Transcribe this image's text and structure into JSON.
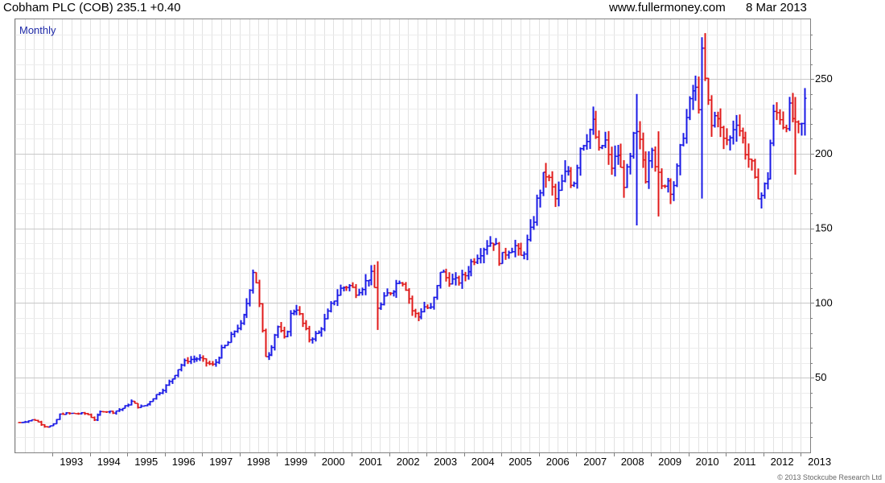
{
  "header": {
    "title": "Cobham PLC (COB) 235.1 +0.40",
    "website": "www.fullermoney.com",
    "date": "8 Mar 2013"
  },
  "copyright": "© 2013 Stockcube Research Ltd",
  "colors": {
    "up": "#1a1ae6",
    "down": "#e01a1a",
    "label": "#1f2aa8"
  },
  "chart_data": {
    "type": "bar",
    "subtype": "ohlc-monthly",
    "period_label": "Monthly",
    "x_range": [
      1992.0,
      2013.25
    ],
    "y_range": [
      0,
      290
    ],
    "y_ticks": [
      50,
      100,
      150,
      200,
      250
    ],
    "y_tick_labels": [
      "50",
      "100",
      "150",
      "200",
      "250"
    ],
    "x_ticks": [
      1993,
      1994,
      1995,
      1996,
      1997,
      1998,
      1999,
      2000,
      2001,
      2002,
      2003,
      2004,
      2005,
      2006,
      2007,
      2008,
      2009,
      2010,
      2011,
      2012,
      2013
    ],
    "x_tick_labels": [
      "1993",
      "1994",
      "1995",
      "1996",
      "1997",
      "1998",
      "1999",
      "2000",
      "2001",
      "2002",
      "2003",
      "2004",
      "2005",
      "2006",
      "2007",
      "2008",
      "2009",
      "2010",
      "2011",
      "2012",
      "2013"
    ],
    "close_anchors": [
      [
        1992.1,
        20
      ],
      [
        1992.5,
        22
      ],
      [
        1992.8,
        17
      ],
      [
        1993.0,
        18
      ],
      [
        1993.2,
        26
      ],
      [
        1993.6,
        26
      ],
      [
        1993.9,
        26
      ],
      [
        1994.1,
        22
      ],
      [
        1994.3,
        28
      ],
      [
        1994.6,
        27
      ],
      [
        1994.9,
        30
      ],
      [
        1995.1,
        34
      ],
      [
        1995.3,
        30
      ],
      [
        1995.5,
        32
      ],
      [
        1995.7,
        37
      ],
      [
        1996.0,
        44
      ],
      [
        1996.2,
        50
      ],
      [
        1996.4,
        58
      ],
      [
        1996.6,
        62
      ],
      [
        1996.9,
        63
      ],
      [
        1997.1,
        60
      ],
      [
        1997.3,
        58
      ],
      [
        1997.5,
        68
      ],
      [
        1997.7,
        74
      ],
      [
        1997.9,
        84
      ],
      [
        1998.05,
        85
      ],
      [
        1998.2,
        102
      ],
      [
        1998.35,
        122
      ],
      [
        1998.45,
        113
      ],
      [
        1998.6,
        80
      ],
      [
        1998.7,
        62
      ],
      [
        1998.85,
        72
      ],
      [
        1999.0,
        85
      ],
      [
        1999.2,
        75
      ],
      [
        1999.35,
        92
      ],
      [
        1999.5,
        98
      ],
      [
        1999.7,
        85
      ],
      [
        1999.85,
        76
      ],
      [
        2000.1,
        80
      ],
      [
        2000.3,
        90
      ],
      [
        2000.5,
        102
      ],
      [
        2000.7,
        110
      ],
      [
        2000.9,
        112
      ],
      [
        2001.1,
        108
      ],
      [
        2001.3,
        112
      ],
      [
        2001.5,
        120
      ],
      [
        2001.6,
        110
      ],
      [
        2001.7,
        95
      ],
      [
        2001.9,
        105
      ],
      [
        2002.1,
        110
      ],
      [
        2002.3,
        117
      ],
      [
        2002.45,
        110
      ],
      [
        2002.6,
        95
      ],
      [
        2002.75,
        90
      ],
      [
        2002.9,
        98
      ],
      [
        2003.1,
        96
      ],
      [
        2003.25,
        108
      ],
      [
        2003.35,
        122
      ],
      [
        2003.55,
        116
      ],
      [
        2003.8,
        114
      ],
      [
        2004.0,
        118
      ],
      [
        2004.2,
        128
      ],
      [
        2004.4,
        134
      ],
      [
        2004.6,
        140
      ],
      [
        2004.8,
        142
      ],
      [
        2004.95,
        128
      ],
      [
        2005.15,
        136
      ],
      [
        2005.35,
        138
      ],
      [
        2005.5,
        130
      ],
      [
        2005.65,
        138
      ],
      [
        2005.8,
        150
      ],
      [
        2005.95,
        170
      ],
      [
        2006.15,
        188
      ],
      [
        2006.3,
        180
      ],
      [
        2006.45,
        168
      ],
      [
        2006.6,
        180
      ],
      [
        2006.75,
        190
      ],
      [
        2006.9,
        178
      ],
      [
        2007.1,
        205
      ],
      [
        2007.3,
        214
      ],
      [
        2007.45,
        220
      ],
      [
        2007.6,
        200
      ],
      [
        2007.75,
        210
      ],
      [
        2007.9,
        190
      ],
      [
        2008.1,
        200
      ],
      [
        2008.25,
        180
      ],
      [
        2008.4,
        190
      ],
      [
        2008.55,
        215
      ],
      [
        2008.7,
        205
      ],
      [
        2008.85,
        185
      ],
      [
        2009.0,
        210
      ],
      [
        2009.1,
        195
      ],
      [
        2009.25,
        175
      ],
      [
        2009.4,
        185
      ],
      [
        2009.55,
        175
      ],
      [
        2009.7,
        190
      ],
      [
        2009.85,
        215
      ],
      [
        2010.0,
        230
      ],
      [
        2010.15,
        248
      ],
      [
        2010.25,
        228
      ],
      [
        2010.35,
        265
      ],
      [
        2010.45,
        245
      ],
      [
        2010.6,
        218
      ],
      [
        2010.75,
        230
      ],
      [
        2010.9,
        208
      ],
      [
        2011.1,
        210
      ],
      [
        2011.25,
        225
      ],
      [
        2011.4,
        212
      ],
      [
        2011.55,
        200
      ],
      [
        2011.7,
        190
      ],
      [
        2011.8,
        175
      ],
      [
        2011.95,
        172
      ],
      [
        2012.1,
        185
      ],
      [
        2012.25,
        225
      ],
      [
        2012.4,
        228
      ],
      [
        2012.55,
        218
      ],
      [
        2012.7,
        230
      ],
      [
        2012.85,
        216
      ],
      [
        2013.0,
        215
      ],
      [
        2013.1,
        235
      ]
    ],
    "highlight_spikes": [
      [
        2001.7,
        82,
        128
      ],
      [
        2008.6,
        152,
        240
      ],
      [
        2009.2,
        158,
        215
      ],
      [
        2010.35,
        170,
        278
      ],
      [
        2012.85,
        186,
        238
      ]
    ]
  }
}
